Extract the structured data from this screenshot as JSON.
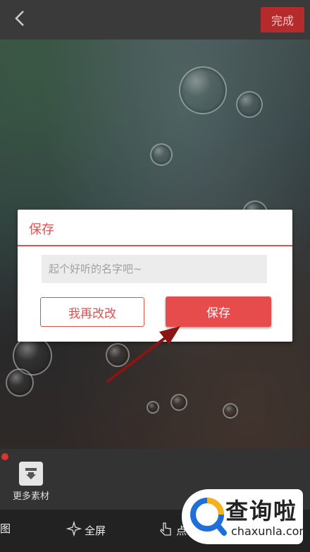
{
  "topbar": {
    "done_label": "完成"
  },
  "dialog": {
    "title": "保存",
    "name_placeholder": "起个好听的名字吧~",
    "cancel_label": "我再改改",
    "save_label": "保存"
  },
  "bottom": {
    "more_materials_label": "更多素材",
    "tabs": [
      {
        "label": "图",
        "icon": "image-icon"
      },
      {
        "label": "全屏",
        "icon": "sparkle-icon"
      },
      {
        "label": "点",
        "icon": "tap-icon"
      }
    ]
  },
  "watermark": {
    "cn": "查询啦",
    "en": "chaxunla.com"
  },
  "colors": {
    "accent": "#e74c4c",
    "done_button": "#b52a2a",
    "dialog_text": "#d9534f"
  }
}
